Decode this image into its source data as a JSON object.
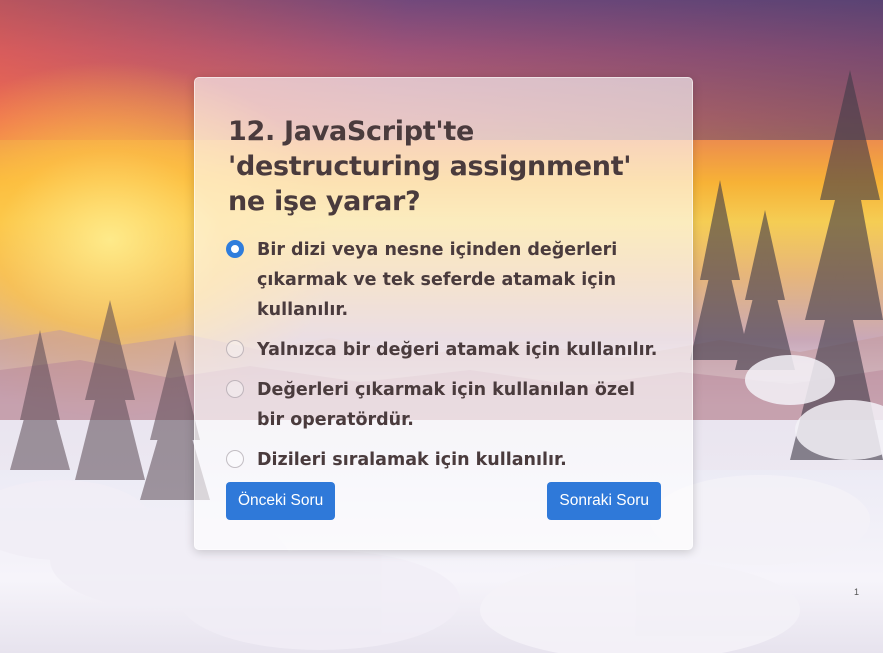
{
  "quiz": {
    "question": "12. JavaScript'te 'destructuring assignment' ne işe yarar?",
    "options": [
      {
        "label": "Bir dizi veya nesne içinden değerleri çıkarmak ve tek seferde atamak için kullanılır.",
        "selected": true
      },
      {
        "label": "Yalnızca bir değeri atamak için kullanılır.",
        "selected": false
      },
      {
        "label": "Değerleri çıkarmak için kullanılan özel bir operatördür.",
        "selected": false
      },
      {
        "label": "Dizileri sıralamak için kullanılır.",
        "selected": false
      }
    ],
    "prev_label": "Önceki Soru",
    "next_label": "Sonraki Soru"
  },
  "page_marker": "1",
  "colors": {
    "accent": "#2f79d9",
    "text": "#4a3b3d"
  }
}
